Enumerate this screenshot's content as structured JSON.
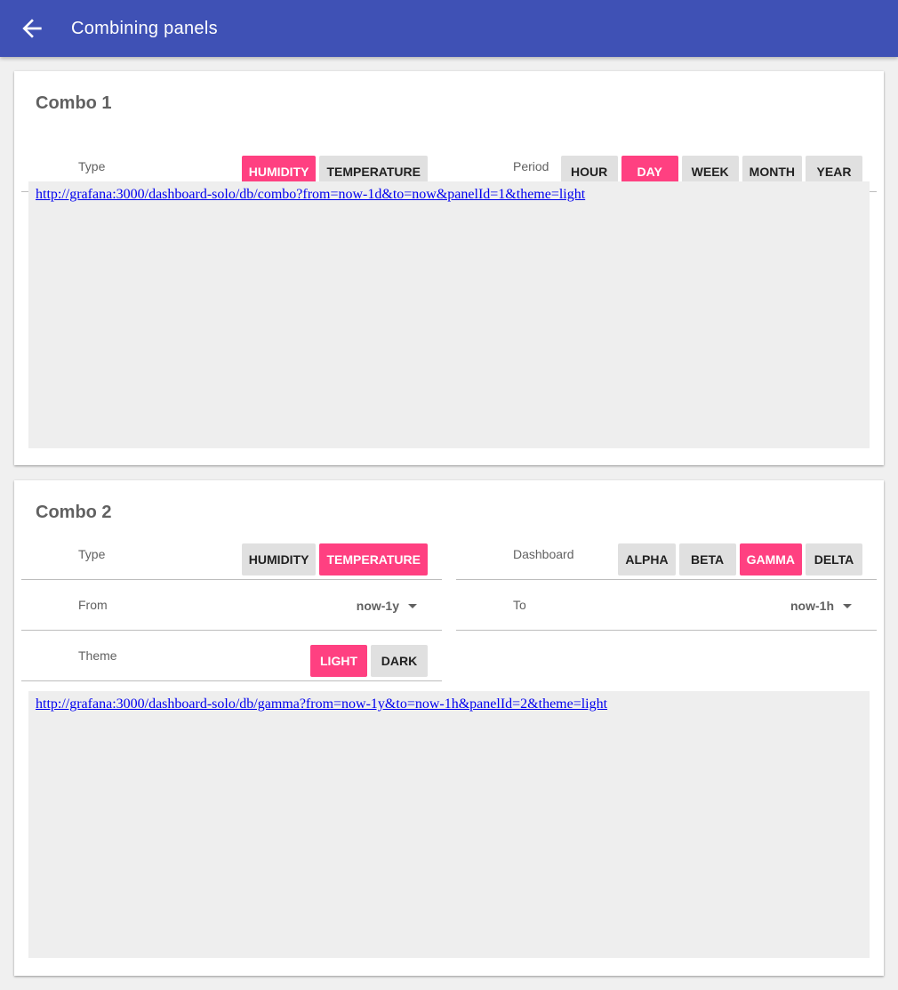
{
  "appbar": {
    "title": "Combining panels",
    "back_icon": "arrow-back-icon"
  },
  "colors": {
    "primary": "#3f51b5",
    "accent": "#ff4081",
    "button": "#e0e0e0",
    "frame": "#eeeeee"
  },
  "combo1": {
    "title": "Combo 1",
    "type": {
      "label": "Type",
      "options": [
        "HUMIDITY",
        "TEMPERATURE"
      ],
      "selected": "HUMIDITY"
    },
    "period": {
      "label": "Period",
      "options": [
        "HOUR",
        "DAY",
        "WEEK",
        "MONTH",
        "YEAR"
      ],
      "selected": "DAY"
    },
    "url": "http://grafana:3000/dashboard-solo/db/combo?from=now-1d&to=now&panelId=1&theme=light"
  },
  "combo2": {
    "title": "Combo 2",
    "type": {
      "label": "Type",
      "options": [
        "HUMIDITY",
        "TEMPERATURE"
      ],
      "selected": "TEMPERATURE"
    },
    "dashboard": {
      "label": "Dashboard",
      "options": [
        "ALPHA",
        "BETA",
        "GAMMA",
        "DELTA"
      ],
      "selected": "GAMMA"
    },
    "from": {
      "label": "From",
      "value": "now-1y"
    },
    "to": {
      "label": "To",
      "value": "now-1h"
    },
    "theme": {
      "label": "Theme",
      "options": [
        "LIGHT",
        "DARK"
      ],
      "selected": "LIGHT"
    },
    "url": "http://grafana:3000/dashboard-solo/db/gamma?from=now-1y&to=now-1h&panelId=2&theme=light"
  }
}
